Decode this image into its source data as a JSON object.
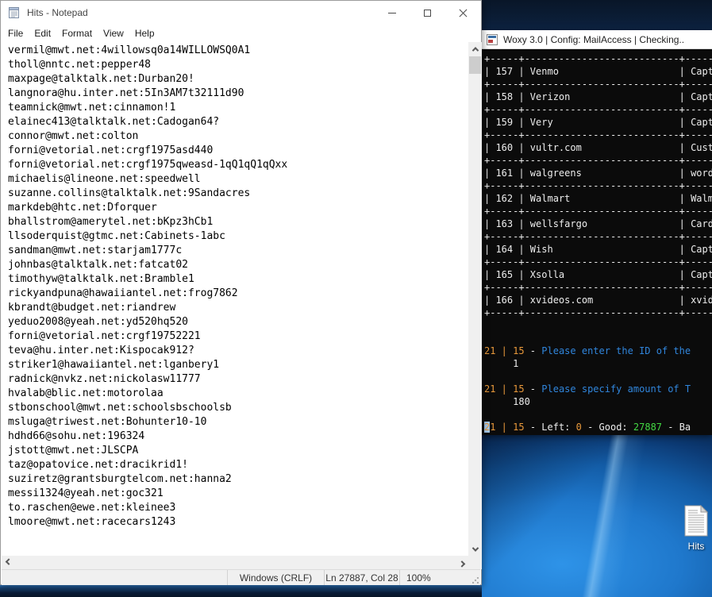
{
  "notepad": {
    "title": "Hits - Notepad",
    "menu": [
      "File",
      "Edit",
      "Format",
      "View",
      "Help"
    ],
    "lines": [
      "vermil@mwt.net:4willowsq0a14WILLOWSQ0A1",
      "tholl@nntc.net:pepper48",
      "maxpage@talktalk.net:Durban20!",
      "langnora@hu.inter.net:5In3AM7t32111d90",
      "teamnick@mwt.net:cinnamon!1",
      "elainec413@talktalk.net:Cadogan64?",
      "connor@mwt.net:colton",
      "forni@vetorial.net:crgf1975asd440",
      "forni@vetorial.net:crgf1975qweasd-1qQ1qQ1qQxx",
      "michaelis@lineone.net:speedwell",
      "suzanne.collins@talktalk.net:9Sandacres",
      "markdeb@htc.net:Dforquer",
      "bhallstrom@amerytel.net:bKpz3hCb1",
      "llsoderquist@gtmc.net:Cabinets-1abc",
      "sandman@mwt.net:starjam1777c",
      "johnbas@talktalk.net:fatcat02",
      "timothyw@talktalk.net:Bramble1",
      "rickyandpuna@hawaiiantel.net:frog7862",
      "kbrandt@budget.net:riandrew",
      "yeduo2008@yeah.net:yd520hq520",
      "forni@vetorial.net:crgf19752221",
      "teva@hu.inter.net:Kispocak912?",
      "striker1@hawaiiantel.net:lganbery1",
      "radnick@nvkz.net:nickolasw11777",
      "hvalab@blic.net:motorolaa",
      "stbonschool@mwt.net:schoolsbschoolsb",
      "msluga@triwest.net:Bohunter10-10",
      "hdhd66@sohu.net:196324",
      "jstott@mwt.net:JLSCPA",
      "taz@opatovice.net:dracikrid1!",
      "suziretz@grantsburgtelcom.net:hanna2",
      "messi1324@yeah.net:goc321",
      "to.raschen@ewe.net:kleinee3",
      "lmoore@mwt.net:racecars1243"
    ],
    "status": {
      "eol": "Windows (CRLF)",
      "position": "Ln 27887, Col 28",
      "zoom": "100%"
    }
  },
  "console": {
    "title": "Woxy 3.0 | Config: MailAccess | Checking..",
    "table": {
      "separator": "+-----+---------------------------+-----",
      "rows": [
        {
          "id": "157",
          "service": "Venmo",
          "tail": "Capt"
        },
        {
          "id": "158",
          "service": "Verizon",
          "tail": "Capt"
        },
        {
          "id": "159",
          "service": "Very",
          "tail": "Capt"
        },
        {
          "id": "160",
          "service": "vultr.com",
          "tail": "Cust"
        },
        {
          "id": "161",
          "service": "walgreens",
          "tail": "word"
        },
        {
          "id": "162",
          "service": "Walmart",
          "tail": "Walm"
        },
        {
          "id": "163",
          "service": "wellsfargo",
          "tail": "Card"
        },
        {
          "id": "164",
          "service": "Wish",
          "tail": "Capt"
        },
        {
          "id": "165",
          "service": "Xsolla",
          "tail": "Capt"
        },
        {
          "id": "166",
          "service": "xvideos.com",
          "tail": "xvid"
        }
      ]
    },
    "messages": [
      [],
      [],
      [
        {
          "t": "21 | 15",
          "c": "orange"
        },
        {
          "t": " - ",
          "c": "plain"
        },
        {
          "t": "Please enter the ID of the",
          "c": "blue"
        }
      ],
      [
        {
          "t": "     1",
          "c": "plain"
        }
      ],
      [],
      [
        {
          "t": "21 | 15",
          "c": "orange"
        },
        {
          "t": " - ",
          "c": "plain"
        },
        {
          "t": "Please specify amount of T",
          "c": "blue"
        }
      ],
      [
        {
          "t": "     180",
          "c": "plain"
        }
      ],
      [],
      [
        {
          "t": "2",
          "c": "orange",
          "cursor": true
        },
        {
          "t": "1 | 15",
          "c": "orange"
        },
        {
          "t": " - Left: ",
          "c": "plain"
        },
        {
          "t": "0",
          "c": "orange"
        },
        {
          "t": " - Good: ",
          "c": "plain"
        },
        {
          "t": "27887",
          "c": "green"
        },
        {
          "t": " - Ba",
          "c": "plain"
        }
      ]
    ],
    "colors": {
      "orange": "#E8993B",
      "blue": "#3086DC",
      "green": "#43D843",
      "plain": "#EDEDED",
      "cursor": "#A6C8E8",
      "background": "#0B0B0B"
    }
  },
  "desktop": {
    "icon_label": "Hits"
  }
}
